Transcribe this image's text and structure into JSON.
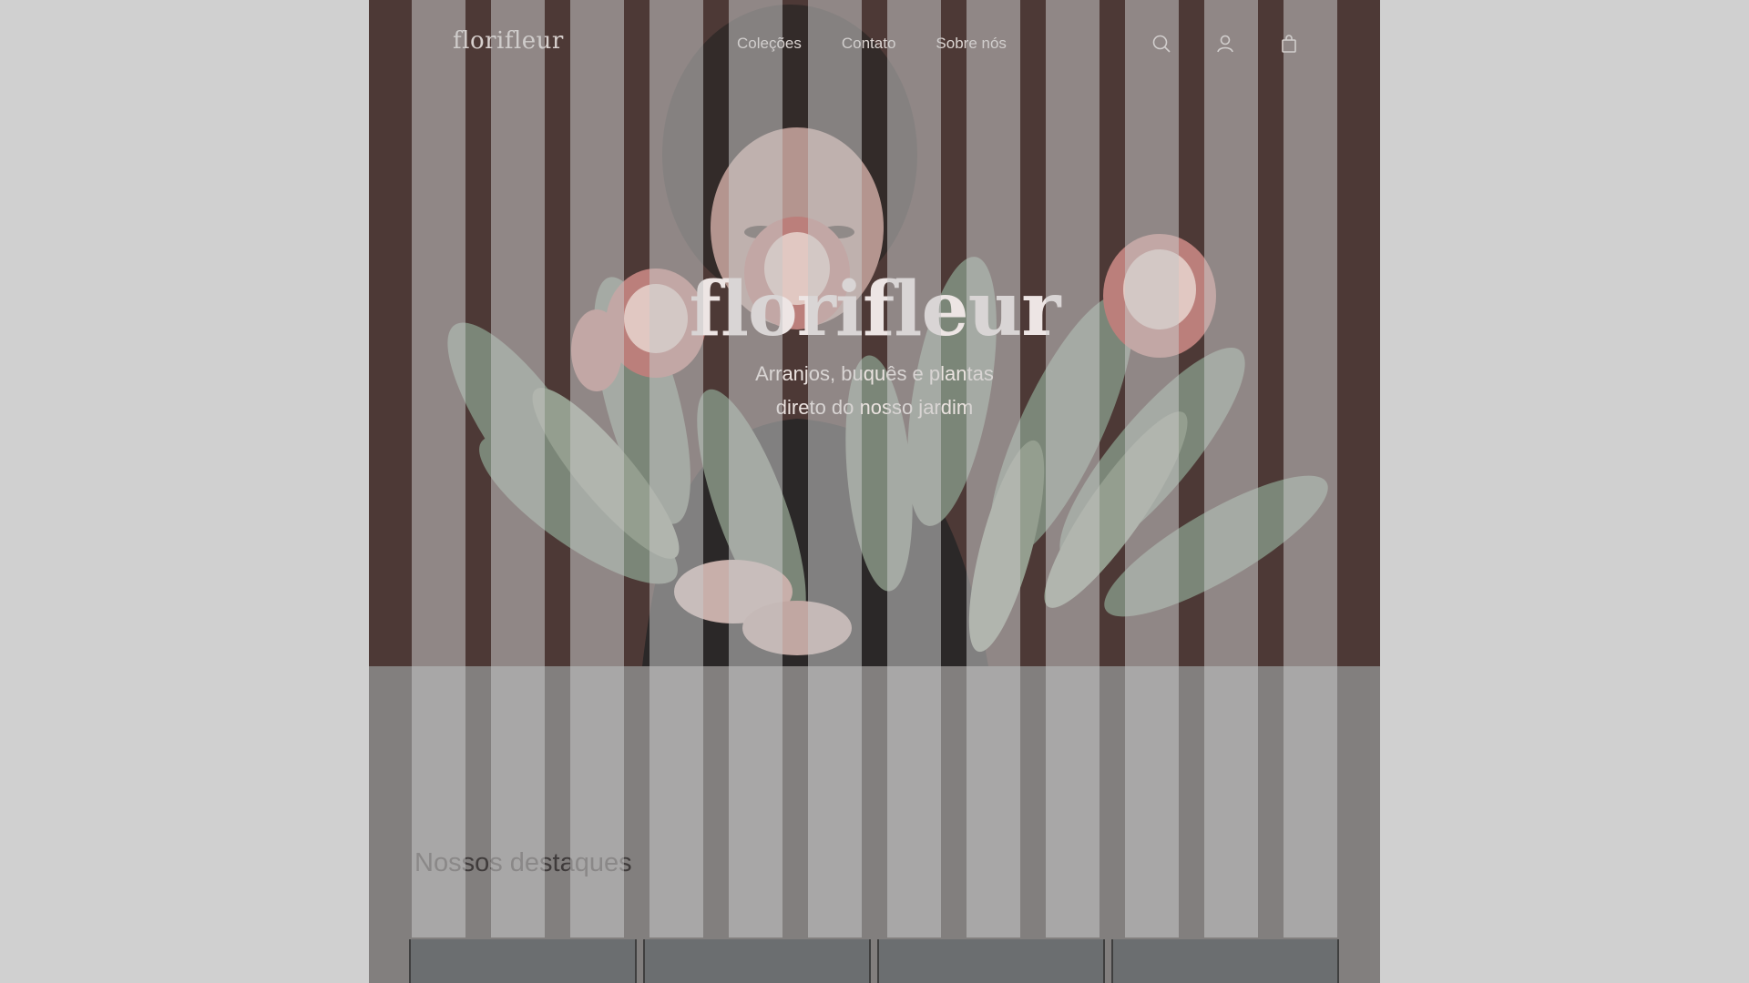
{
  "site": {
    "logo": "florifleur"
  },
  "nav": {
    "links": [
      "Coleções",
      "Contato",
      "Sobre nós"
    ],
    "icons": [
      "search-icon",
      "user-icon",
      "bag-icon"
    ]
  },
  "hero": {
    "title": "florifleur",
    "subtitle_line1": "Arranjos, buquês e plantas",
    "subtitle_line2": "direto do nosso jardim"
  },
  "highlights": {
    "title": "Nossos destaques"
  },
  "colors": {
    "hero_bg": "#3b2420",
    "page_bg": "#d0d0d0",
    "section_bg": "#777372"
  }
}
